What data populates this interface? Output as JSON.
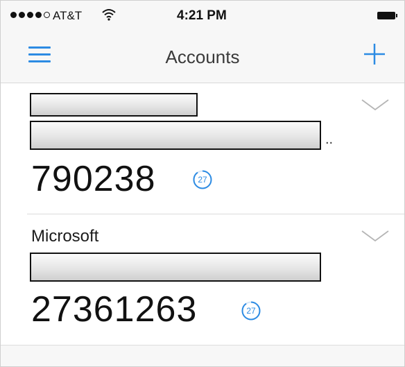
{
  "status_bar": {
    "carrier": "AT&T",
    "time": "4:21 PM",
    "signal_bars_filled": 4,
    "signal_bars_total": 5,
    "wifi_icon": "wifi-icon",
    "battery_icon": "battery-icon"
  },
  "nav": {
    "title": "Accounts",
    "menu_icon": "hamburger-menu-icon",
    "add_icon": "plus-icon",
    "accent_color": "#2c8be3"
  },
  "accounts": [
    {
      "name": "",
      "email_redacted": true,
      "code": "790238",
      "seconds_remaining": "27",
      "expand_icon": "chevron-down-icon"
    },
    {
      "name": "Microsoft",
      "email_redacted": true,
      "code": "27361263",
      "seconds_remaining": "27",
      "expand_icon": "chevron-down-icon"
    }
  ]
}
